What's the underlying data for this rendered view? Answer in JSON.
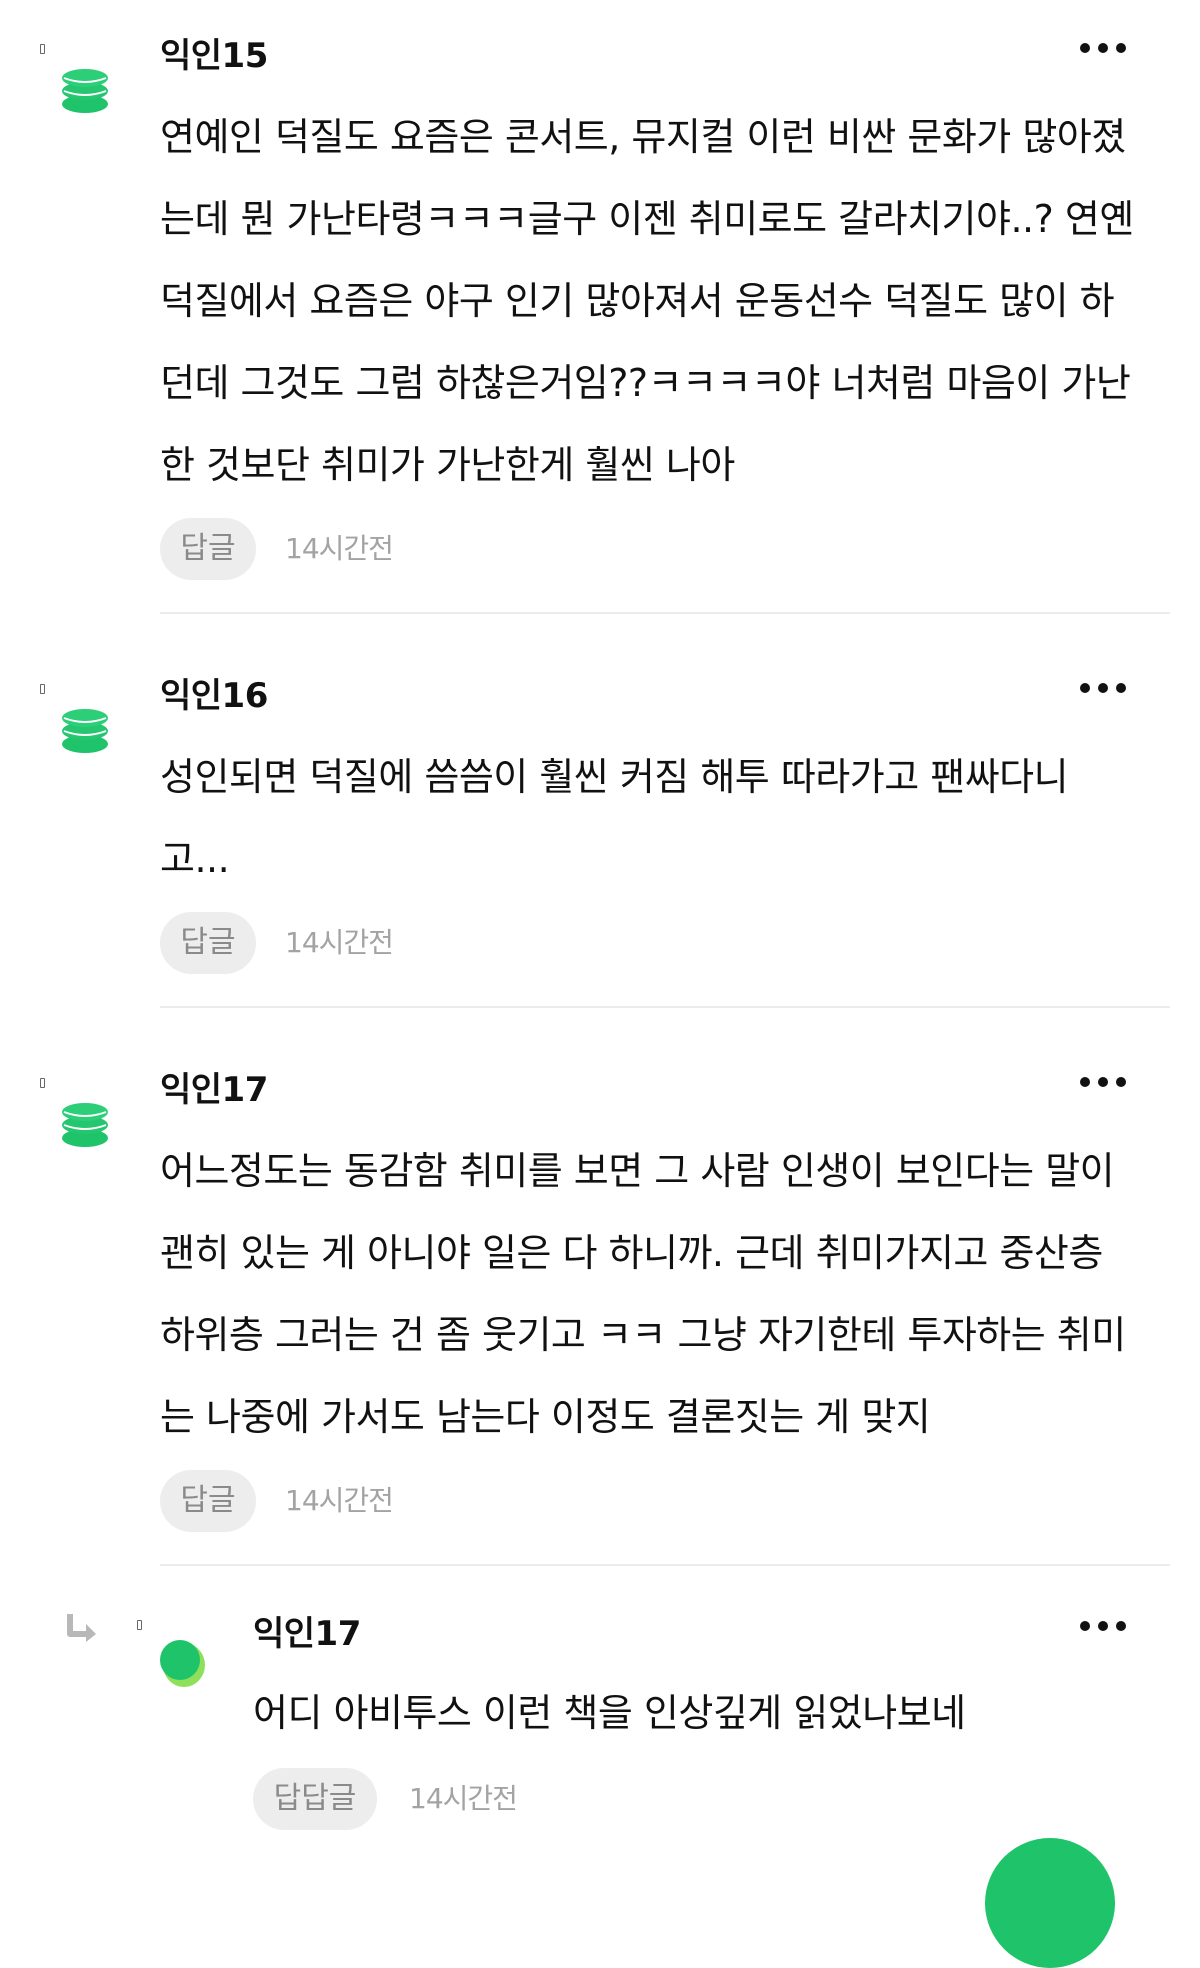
{
  "colors": {
    "accent_green": "#1fc36a",
    "light_green": "#8ee05a",
    "button_bg": "#ededed",
    "time_gray": "#a3a3a3"
  },
  "comments": [
    {
      "nickname": "익인15",
      "text": "연예인 덕질도 요즘은 콘서트, 뮤지컬 이런 비싼 문화가 많아졌\n는데 뭔 가난타령ㅋㅋㅋ글구 이젠 취미로도 갈라치기야..? 연옌\n덕질에서 요즘은 야구 인기 많아져서 운동선수 덕질도 많이 하\n던데 그것도 그럼 하찮은거임??ㅋㅋㅋㅋ야 너처럼 마음이 가난\n한 것보단 취미가 가난한게 훨씬 나아",
      "reply_label": "답글",
      "time": "14시간전",
      "avatar_icon": "stacked-coins-icon"
    },
    {
      "nickname": "익인16",
      "text": "성인되면 덕질에 씀씀이 훨씬 커짐 해투 따라가고 팬싸다니\n고...",
      "reply_label": "답글",
      "time": "14시간전",
      "avatar_icon": "stacked-coins-icon"
    },
    {
      "nickname": "익인17",
      "text": "어느정도는 동감함 취미를 보면 그 사람 인생이 보인다는 말이\n괜히 있는 게 아니야 일은 다 하니까. 근데 취미가지고 중산층\n하위층 그러는 건 좀 웃기고 ㅋㅋ 그냥 자기한테 투자하는 취미\n는 나중에 가서도 남는다 이정도 결론짓는 게 맞지",
      "reply_label": "답글",
      "time": "14시간전",
      "avatar_icon": "stacked-coins-icon"
    }
  ],
  "reply": {
    "nickname": "익인17",
    "text": "어디 아비투스 이런 책을 인상깊게 읽었나보네",
    "reply_label": "답답글",
    "time": "14시간전",
    "reply_arrow_icon": "reply-arrow-icon",
    "avatar_icon": "green-circle-icon"
  },
  "more_icon": "more-dots-icon",
  "fab_icon": "write-button"
}
